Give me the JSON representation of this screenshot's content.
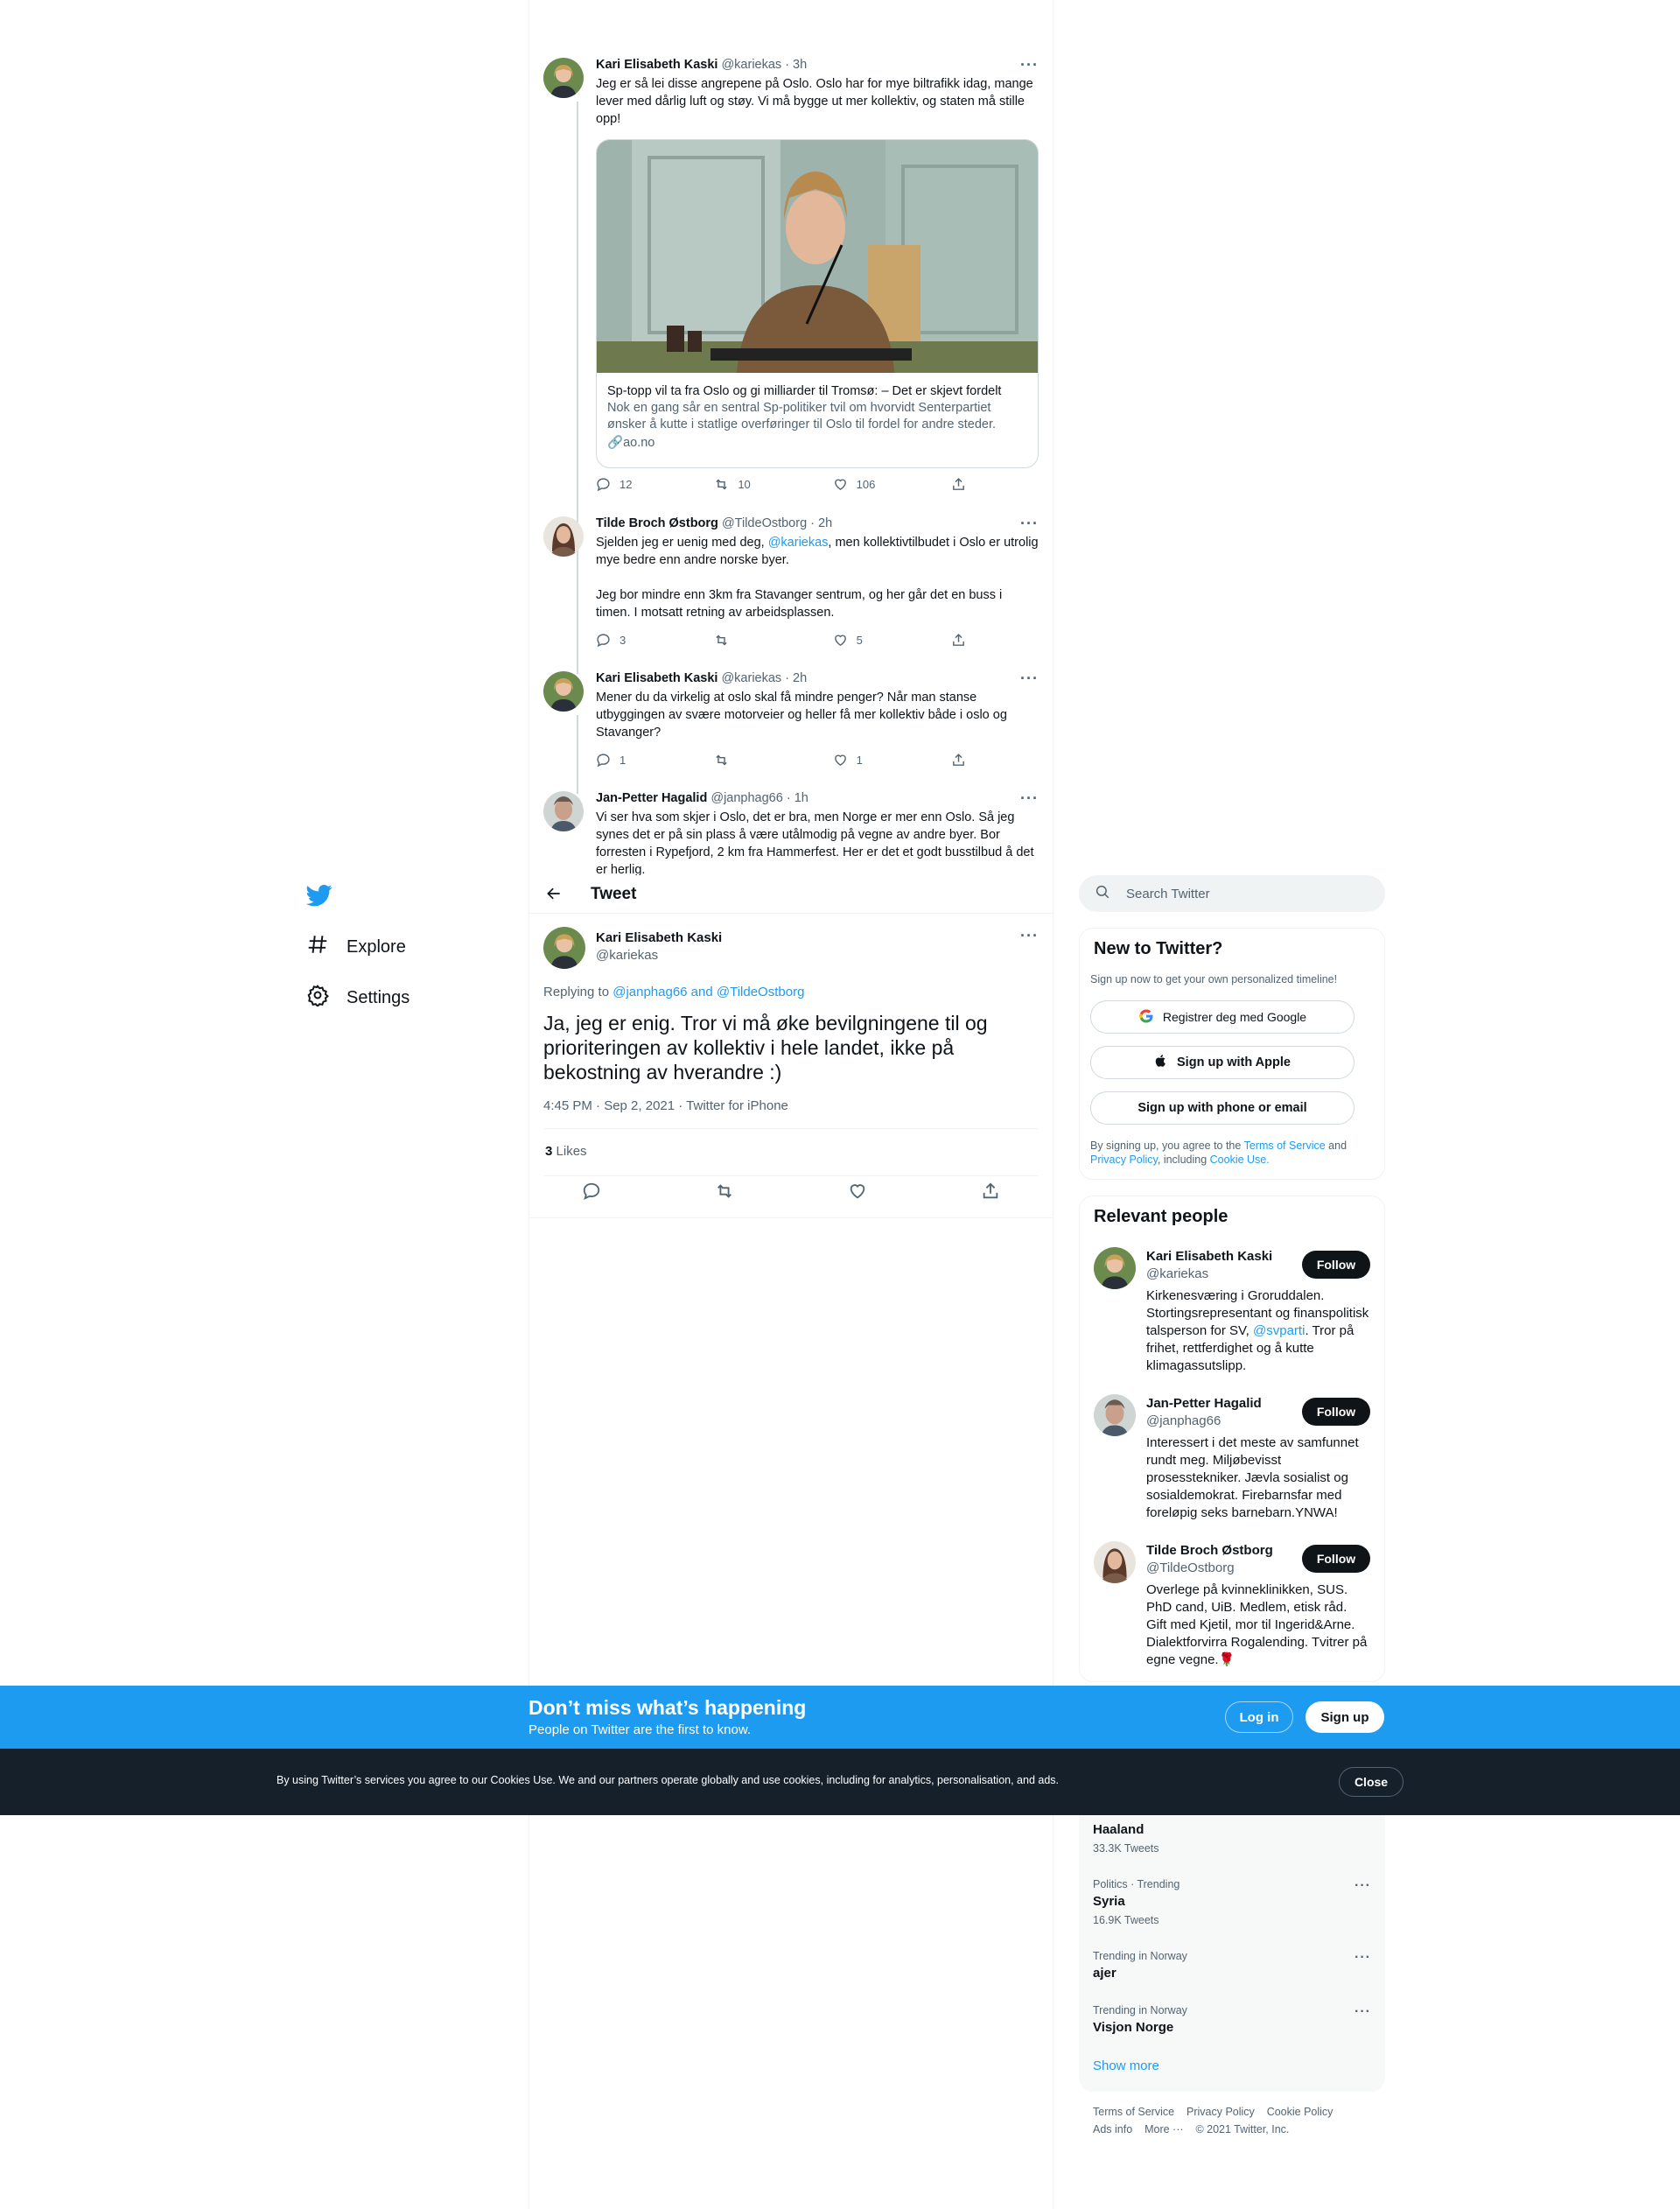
{
  "nav": {
    "items": [
      {
        "label": "Explore",
        "icon": "hashtag-icon"
      },
      {
        "label": "Settings",
        "icon": "gear-icon"
      }
    ]
  },
  "thread": [
    {
      "name": "Kari Elisabeth Kaski",
      "handle": "@kariekas · 3h",
      "text": "Jeg er så lei disse angrepene på Oslo. Oslo har for mye biltrafikk idag, mange lever med dårlig luft og støy. Vi må bygge ut mer kollektiv, og staten må stille opp!",
      "card": {
        "title": "Sp-topp vil ta fra Oslo og gi milliarder til Tromsø: – Det er skjevt fordelt",
        "description": "Nok en gang sår en sentral Sp-politiker tvil om hvorvidt Senterpartiet ønsker å kutte i statlige overføringer til Oslo til fordel for andre steder.",
        "domain": "ao.no"
      },
      "replies": "12",
      "retweets": "10",
      "likes": "106"
    },
    {
      "name": "Tilde Broch Østborg",
      "handle": "@TildeOstborg · 2h",
      "text_before": "Sjelden jeg er uenig med deg, ",
      "mention": "@kariekas",
      "text_after": ", men kollektivtilbudet i Oslo er utrolig mye bedre enn andre norske byer.",
      "text2": "Jeg bor mindre enn 3km fra Stavanger sentrum, og her går det en buss i timen. I motsatt retning av arbeidsplassen.",
      "replies": "3",
      "retweets": "",
      "likes": "5"
    },
    {
      "name": "Kari Elisabeth Kaski",
      "handle": "@kariekas · 2h",
      "text": "Mener du da virkelig at oslo skal få mindre penger? Når man stanse utbyggingen av svære motorveier og heller få mer kollektiv både i oslo og Stavanger?",
      "replies": "1",
      "retweets": "",
      "likes": "1"
    },
    {
      "name": "Jan-Petter Hagalid",
      "handle": "@janphag66 · 1h",
      "text": "Vi ser hva som skjer i Oslo, det er bra, men Norge er mer enn Oslo. Så jeg synes det er på sin plass å være utålmodig på vegne av andre byer. Bor forresten i Rypefjord, 2 km fra Hammerfest. Her er det et godt busstilbud å det er herlig."
    }
  ],
  "header": {
    "title": "Tweet"
  },
  "main_tweet": {
    "name": "Kari Elisabeth Kaski",
    "handle": "@kariekas",
    "replying_label": "Replying to ",
    "replying_to": "@janphag66 and @TildeOstborg",
    "text": "Ja, jeg er enig. Tror vi må øke bevilgningene til og prioriteringen av kollektiv i hele landet, ikke på bekostning av hverandre :)",
    "meta": "4:45 PM · Sep 2, 2021 · Twitter for iPhone",
    "likes_count": "3",
    "likes_label": "Likes"
  },
  "search": {
    "placeholder": "Search Twitter"
  },
  "signup_panel": {
    "title": "New to Twitter?",
    "subtitle": "Sign up now to get your own personalized timeline!",
    "google": "Registrer deg med Google",
    "apple": "Sign up with Apple",
    "phone": "Sign up with phone or email",
    "terms_1": "By signing up, you agree to the ",
    "terms_link1": "Terms of Service",
    "terms_2": " and ",
    "terms_link2": "Privacy Policy",
    "terms_3": ", including ",
    "terms_link3": "Cookie Use."
  },
  "relevant": {
    "title": "Relevant people",
    "follow_label": "Follow",
    "people": [
      {
        "name": "Kari Elisabeth Kaski",
        "handle": "@kariekas",
        "bio_before": "Kirkenesværing i Groruddalen. Stortingsrepresentant og finanspolitisk talsperson for SV, ",
        "bio_link": "@svparti",
        "bio_after": ". Tror på frihet, rettferdighet og å kutte klimagassutslipp."
      },
      {
        "name": "Jan-Petter Hagalid",
        "handle": "@janphag66",
        "bio": "Interessert i det meste av samfunnet rundt meg. Miljøbevisst prosesstekniker. Jævla sosialist og sosialdemokrat. Firebarnsfar med foreløpig seks barnebarn.YNWA!"
      },
      {
        "name": "Tilde Broch Østborg",
        "handle": "@TildeOstborg",
        "bio": "Overlege på kvinneklinikken, SUS. PhD cand, UiB. Medlem, etisk råd. Gift med Kjetil, mor til Ingerid&Arne. Dialektforvirra Rogalending. Tvitrer på egne vegne.🌹"
      }
    ]
  },
  "trends": [
    {
      "category": "",
      "name": "Haaland",
      "tweets": "33.3K Tweets"
    },
    {
      "category": "Politics · Trending",
      "name": "Syria",
      "tweets": "16.9K Tweets"
    },
    {
      "category": "Trending in Norway",
      "name": "ajer",
      "tweets": ""
    },
    {
      "category": "Trending in Norway",
      "name": "Visjon Norge",
      "tweets": ""
    }
  ],
  "show_more": "Show more",
  "footer": {
    "links": [
      "Terms of Service",
      "Privacy Policy",
      "Cookie Policy",
      "Ads info",
      "More ···"
    ],
    "copyright": "© 2021 Twitter, Inc."
  },
  "signup_bar": {
    "title": "Don’t miss what’s happening",
    "subtitle": "People on Twitter are the first to know.",
    "login": "Log in",
    "signup": "Sign up"
  },
  "cookie_bar": {
    "text": "By using Twitter’s services you agree to our Cookies Use. We and our partners operate globally and use cookies, including for analytics, personalisation, and ads.",
    "close": "Close"
  },
  "colors": {
    "accent": "#1d9bf0",
    "dark": "#0f1419",
    "muted": "#536471",
    "cookie_bg": "#15202b"
  }
}
